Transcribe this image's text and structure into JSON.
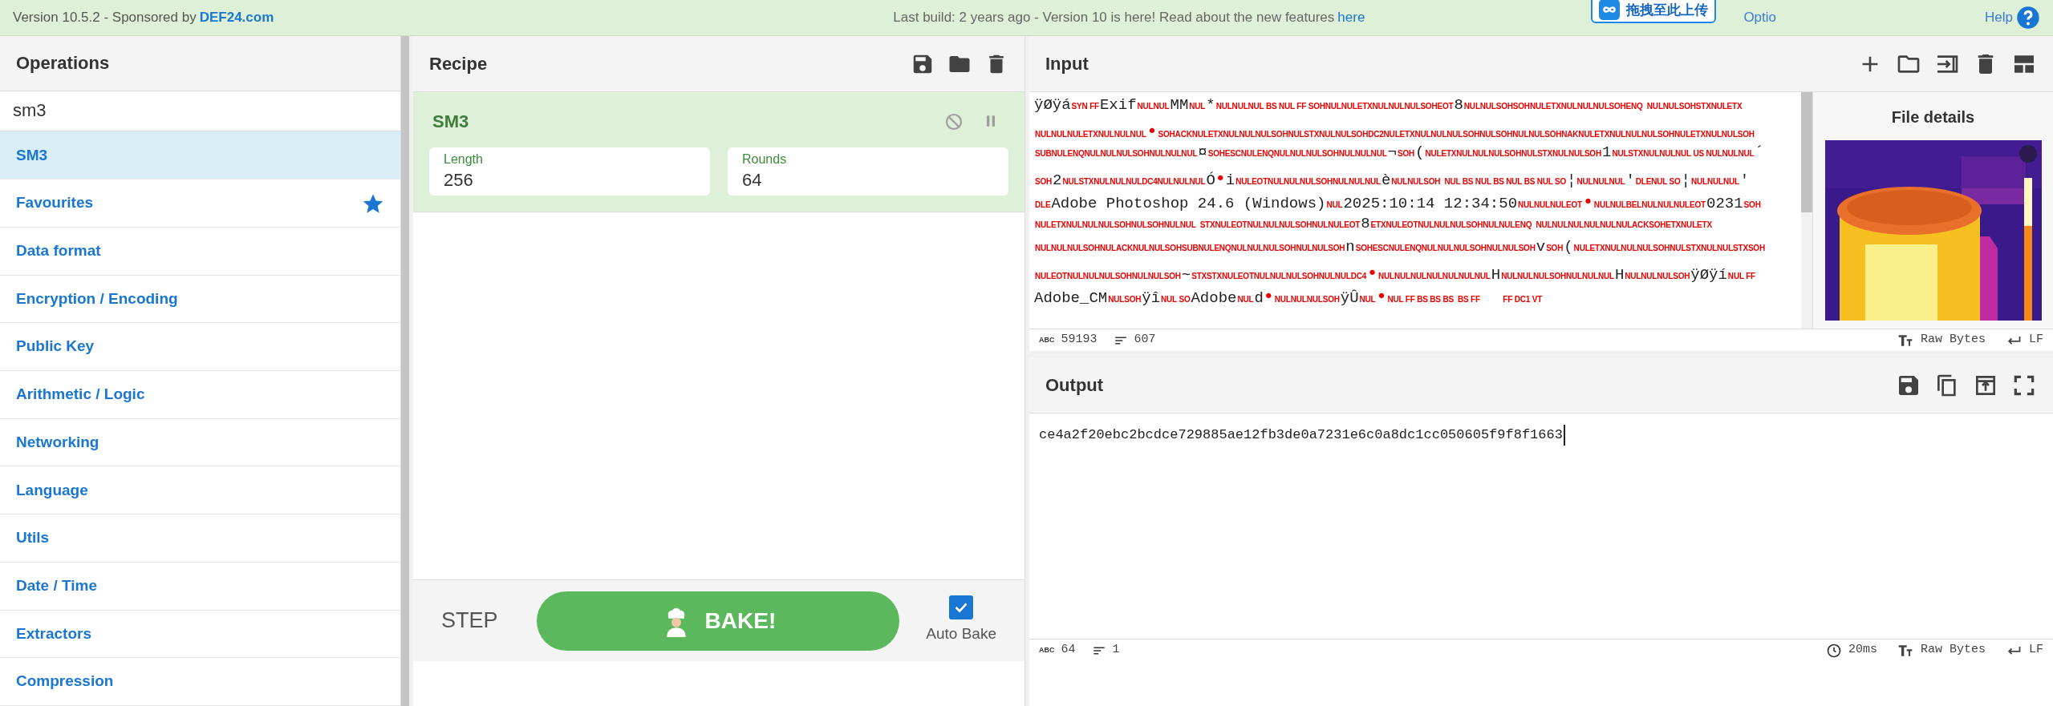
{
  "banner": {
    "version": "Version 10.5.2 - ",
    "sponsor_label": "Sponsored by ",
    "sponsor_link": "DEF24.com",
    "notice": "Last build: 2 years ago - Version 10 is here! Read about the new features ",
    "notice_link": "here",
    "options": "Optio",
    "upload_widget": "拖拽至此上传",
    "help": "Help"
  },
  "operations": {
    "title": "Operations",
    "search": {
      "value": "sm3"
    },
    "items": [
      {
        "label": "SM3",
        "selected": true,
        "favourite": false
      },
      {
        "label": "Favourites",
        "selected": false,
        "favourite": true
      },
      {
        "label": "Data format",
        "selected": false,
        "favourite": false
      },
      {
        "label": "Encryption / Encoding",
        "selected": false,
        "favourite": false
      },
      {
        "label": "Public Key",
        "selected": false,
        "favourite": false
      },
      {
        "label": "Arithmetic / Logic",
        "selected": false,
        "favourite": false
      },
      {
        "label": "Networking",
        "selected": false,
        "favourite": false
      },
      {
        "label": "Language",
        "selected": false,
        "favourite": false
      },
      {
        "label": "Utils",
        "selected": false,
        "favourite": false
      },
      {
        "label": "Date / Time",
        "selected": false,
        "favourite": false
      },
      {
        "label": "Extractors",
        "selected": false,
        "favourite": false
      },
      {
        "label": "Compression",
        "selected": false,
        "favourite": false
      }
    ]
  },
  "recipe": {
    "title": "Recipe",
    "operation": {
      "name": "SM3",
      "disabled": false,
      "args": [
        {
          "label": "Length",
          "value": "256"
        },
        {
          "label": "Rounds",
          "value": "64"
        }
      ]
    },
    "step": "STEP",
    "bake": "BAKE!",
    "auto_bake": {
      "label": "Auto Bake",
      "checked": true
    }
  },
  "input": {
    "title": "Input",
    "lines": [
      [
        {
          "kind": "text",
          "text": "ÿØÿá"
        },
        {
          "kind": "ctrl",
          "text": "SYN FF"
        },
        {
          "kind": "text",
          "text": "Exif"
        },
        {
          "kind": "ctrl",
          "text": "NULNUL"
        },
        {
          "kind": "text",
          "text": "MM"
        },
        {
          "kind": "ctrl",
          "text": "NUL"
        },
        {
          "kind": "text",
          "text": "*"
        },
        {
          "kind": "ctrl",
          "text": "NULNULNUL BS NUL FF SOHNULNULETXNULNULNULSOHEOT"
        },
        {
          "kind": "text",
          "text": "8"
        },
        {
          "kind": "ctrl",
          "text": "NULNULSOHSOHNULETXNULNULNULSOHENQ  NULNULSOHSTXNULETX"
        }
      ],
      [
        {
          "kind": "ctrl",
          "text": "NULNULNULETXNULNULNUL"
        },
        {
          "kind": "dot",
          "text": "•"
        },
        {
          "kind": "ctrl",
          "text": "SOHACKNULETXNULNULNULSOHNULSTXNULNULSOHDC2NULETXNULNULNULSOHNULSOHNULNULSOHNAKNULETXNULNULNULSOHNULETXNULNULSOH"
        }
      ],
      [
        {
          "kind": "ctrl",
          "text": "SUBNULENQNULNULNULSOHNULNULNUL"
        },
        {
          "kind": "text",
          "text": "¤"
        },
        {
          "kind": "ctrl",
          "text": "SOHESCNULENQNULNULNULSOHNULNULNUL"
        },
        {
          "kind": "text",
          "text": "¬"
        },
        {
          "kind": "ctrl",
          "text": "SOH"
        },
        {
          "kind": "text",
          "text": "("
        },
        {
          "kind": "ctrl",
          "text": "NULETXNULNULNULSOHNULSTXNULNULSOH"
        },
        {
          "kind": "text",
          "text": "1"
        },
        {
          "kind": "ctrl",
          "text": "NULSTXNULNULNUL US NULNULNUL"
        },
        {
          "kind": "text",
          "text": "´"
        }
      ],
      [
        {
          "kind": "ctrl",
          "text": "SOH"
        },
        {
          "kind": "text",
          "text": "2"
        },
        {
          "kind": "ctrl",
          "text": "NULSTXNULNULNULDC4NULNULNUL"
        },
        {
          "kind": "text",
          "text": "Ó"
        },
        {
          "kind": "dot",
          "text": "•"
        },
        {
          "kind": "text",
          "text": "i"
        },
        {
          "kind": "ctrl",
          "text": "NULEOTNULNULNULSOHNULNULNUL"
        },
        {
          "kind": "text",
          "text": "è"
        },
        {
          "kind": "ctrl",
          "text": "NULNULSOH  NUL BS NUL BS NUL BS NUL SO"
        },
        {
          "kind": "text",
          "text": "¦"
        },
        {
          "kind": "ctrl",
          "text": "NULNULNUL"
        },
        {
          "kind": "text",
          "text": "'"
        },
        {
          "kind": "ctrl",
          "text": "DLENUL SO"
        },
        {
          "kind": "text",
          "text": "¦"
        },
        {
          "kind": "ctrl",
          "text": "NULNULNUL"
        },
        {
          "kind": "text",
          "text": "'"
        }
      ],
      [
        {
          "kind": "ctrl",
          "text": "DLE"
        },
        {
          "kind": "text",
          "text": "Adobe Photoshop 24.6 (Windows)"
        },
        {
          "kind": "ctrl",
          "text": "NUL"
        },
        {
          "kind": "text",
          "text": "2025:10:14 12:34:50"
        },
        {
          "kind": "ctrl",
          "text": "NULNULNULEOT"
        },
        {
          "kind": "dot",
          "text": "•"
        },
        {
          "kind": "ctrl",
          "text": "NULNULBELNULNULNULEOT"
        },
        {
          "kind": "text",
          "text": "0231"
        },
        {
          "kind": "ctrl",
          "text": "SOH"
        }
      ],
      [
        {
          "kind": "ctrl",
          "text": "NULETXNULNULNULSOHNULSOHNULNUL  STXNULEOTNULNULNULSOHNULNULEOT"
        },
        {
          "kind": "text",
          "text": "8"
        },
        {
          "kind": "ctrl",
          "text": "ETXNULEOTNULNULNULSOHNULNULENQ  NULNULNULNULNULNULACKSOHETXNULETX"
        }
      ],
      [
        {
          "kind": "ctrl",
          "text": "NULNULNULSOHNULACKNULNULSOHSUBNULENQNULNULNULSOHNULNULSOH"
        },
        {
          "kind": "text",
          "text": "n"
        },
        {
          "kind": "ctrl",
          "text": "SOHESCNULENQNULNULNULSOHNULNULSOH"
        },
        {
          "kind": "text",
          "text": "v"
        },
        {
          "kind": "ctrl",
          "text": "SOH"
        },
        {
          "kind": "text",
          "text": "("
        },
        {
          "kind": "ctrl",
          "text": "NULETXNULNULNULSOHNULSTXNULNULSTXSOH"
        }
      ],
      [
        {
          "kind": "ctrl",
          "text": "NULEOTNULNULNULSOHNULNULSOH"
        },
        {
          "kind": "text",
          "text": "~"
        },
        {
          "kind": "ctrl",
          "text": "STXSTXNULEOTNULNULNULSOHNULNULDC4"
        },
        {
          "kind": "dot",
          "text": "•"
        },
        {
          "kind": "ctrl",
          "text": "NULNULNULNULNULNULNUL"
        },
        {
          "kind": "text",
          "text": "H"
        },
        {
          "kind": "ctrl",
          "text": "NULNULNULSOHNULNULNUL"
        },
        {
          "kind": "text",
          "text": "H"
        },
        {
          "kind": "ctrl",
          "text": "NULNULNULSOH"
        },
        {
          "kind": "text",
          "text": "ÿØÿí"
        },
        {
          "kind": "ctrl",
          "text": "NUL FF"
        }
      ],
      [
        {
          "kind": "text",
          "text": "Adobe_CM"
        },
        {
          "kind": "ctrl",
          "text": "NULSOH"
        },
        {
          "kind": "text",
          "text": "ÿî"
        },
        {
          "kind": "ctrl",
          "text": "NUL SO"
        },
        {
          "kind": "text",
          "text": "Adobe"
        },
        {
          "kind": "ctrl",
          "text": "NUL"
        },
        {
          "kind": "text",
          "text": "d"
        },
        {
          "kind": "dot",
          "text": "•"
        },
        {
          "kind": "ctrl",
          "text": "NULNULNULSOH"
        },
        {
          "kind": "text",
          "text": "ÿÛ"
        },
        {
          "kind": "ctrl",
          "text": "NUL"
        },
        {
          "kind": "dot",
          "text": "•"
        },
        {
          "kind": "ctrl",
          "text": "NUL FF BS BS BS  BS FF           FF DC1 VT"
        }
      ]
    ],
    "file_details": {
      "title": "File details",
      "kind": "picture"
    },
    "status": {
      "abc": "ABC",
      "length": "59193",
      "lines": "607",
      "encoding": "Raw Bytes",
      "eol": "LF"
    }
  },
  "output": {
    "title": "Output",
    "value": "ce4a2f20ebc2bcdce729885ae12fb3de0a7231e6c0a8dc1cc050605f9f8f1663",
    "status": {
      "abc": "ABC",
      "length": "64",
      "lines": "1",
      "time": "20ms",
      "encoding": "Raw Bytes",
      "eol": "LF"
    }
  }
}
